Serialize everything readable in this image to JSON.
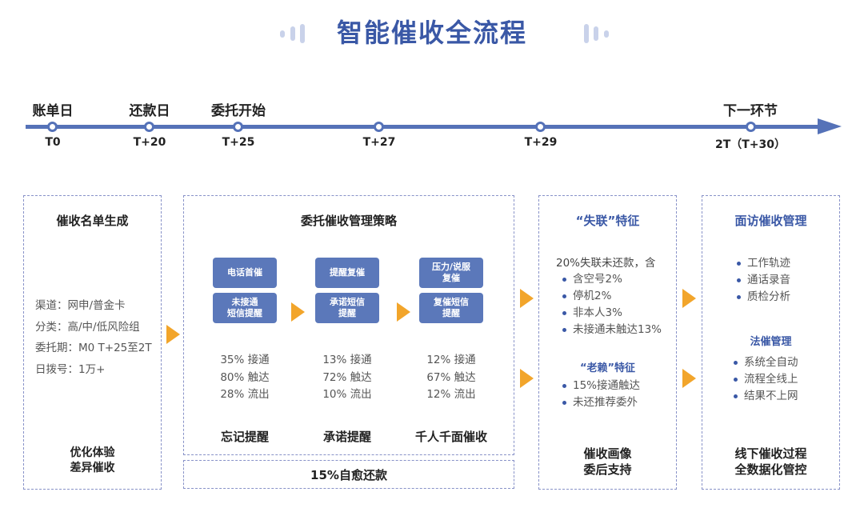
{
  "header": {
    "title": "智能催收全流程"
  },
  "timeline": {
    "nodes": [
      {
        "top_label": "账单日",
        "bottom_label": "T0"
      },
      {
        "top_label": "还款日",
        "bottom_label": "T+20"
      },
      {
        "top_label": "委托开始",
        "bottom_label": "T+25"
      },
      {
        "top_label": "",
        "bottom_label": "T+27"
      },
      {
        "top_label": "",
        "bottom_label": "T+29"
      },
      {
        "top_label": "下一环节",
        "bottom_label": "2T（T+30）"
      }
    ]
  },
  "list_generation": {
    "title": "催收名单生成",
    "lines": [
      "渠道：网申/普金卡",
      "分类：高/中/低风险组",
      "委托期：M0 T+25至2T",
      "日拨号：1万+"
    ],
    "footer_line1": "优化体验",
    "footer_line2": "差异催收"
  },
  "strategy": {
    "title": "委托催收管理策略",
    "stages": [
      {
        "chip_top": "电话首催",
        "chip_bottom": "未接通\n短信提醒",
        "stats": [
          "35% 接通",
          "80% 触达",
          "28% 流出"
        ],
        "footer": "忘记提醒"
      },
      {
        "chip_top": "提醒复催",
        "chip_bottom": "承诺短信\n提醒",
        "stats": [
          "13% 接通",
          "72% 触达",
          "10% 流出"
        ],
        "footer": "承诺提醒"
      },
      {
        "chip_top": "压力/说服\n复催",
        "chip_bottom": "复催短信\n提醒",
        "stats": [
          "12% 接通",
          "67% 触达",
          "12% 流出"
        ],
        "footer": "千人千面催收"
      }
    ],
    "self_cure": "15%自愈还款"
  },
  "lost_contact": {
    "title": "“失联”特征",
    "intro": "20%失联未还款，含",
    "bullets": [
      "含空号2%",
      "停机2%",
      "非本人3%",
      "未接通未触达13%"
    ],
    "sub_title": "“老赖”特征",
    "sub_bullets": [
      "15%接通触达",
      "未还推荐委外"
    ],
    "footer_line1": "催收画像",
    "footer_line2": "委后支持"
  },
  "visit": {
    "title": "面访催收管理",
    "bullets": [
      "工作轨迹",
      "通话录音",
      "质检分析"
    ],
    "sub_title": "法催管理",
    "sub_bullets": [
      "系统全自动",
      "流程全线上",
      "结果不上网"
    ],
    "footer_line1": "线下催收过程",
    "footer_line2": "全数据化管控"
  },
  "colors": {
    "title_blue": "#3a58a6",
    "timeline_blue": "#5572b8",
    "chip_blue": "#5b78ba",
    "arrow_orange": "#f2a52b",
    "dash_border": "#8892c8"
  }
}
